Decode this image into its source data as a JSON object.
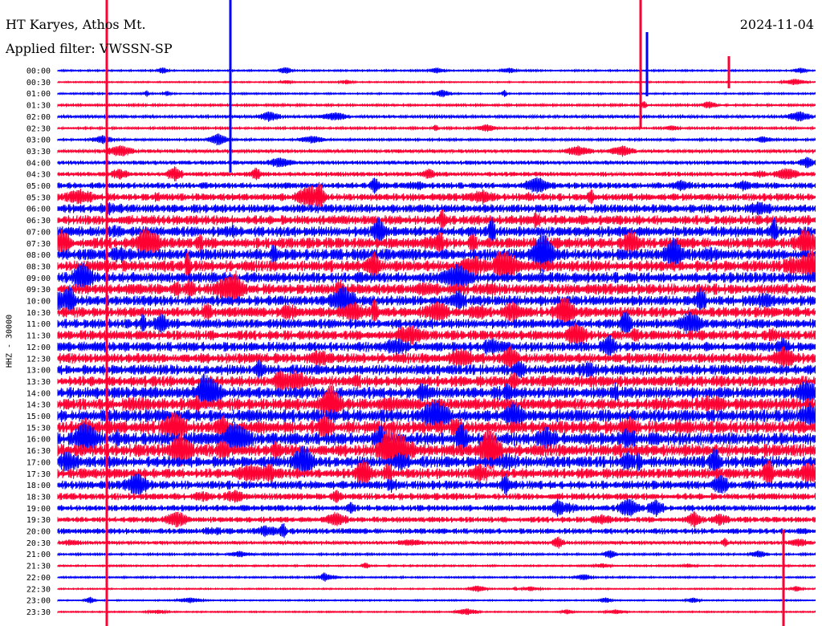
{
  "header": {
    "station": "HT Karyes, Athos Mt.",
    "filter": "Applied filter: VWSSN-SP",
    "date": "2024-11-04"
  },
  "chart_data": {
    "type": "line",
    "title": "HT Karyes, Athos Mt.",
    "subtitle": "Applied filter: VWSSN-SP",
    "date": "2024-11-04",
    "ylabel": "HHZ - 30000",
    "trace_colors": [
      "#0000ff",
      "#ff0033"
    ],
    "row_labels": [
      "00:00",
      "00:30",
      "01:00",
      "01:30",
      "02:00",
      "02:30",
      "03:00",
      "03:30",
      "04:00",
      "04:30",
      "05:00",
      "05:30",
      "06:00",
      "06:30",
      "07:00",
      "07:30",
      "08:00",
      "08:30",
      "09:00",
      "09:30",
      "10:00",
      "10:30",
      "11:00",
      "11:30",
      "12:00",
      "12:30",
      "13:00",
      "13:30",
      "14:00",
      "14:30",
      "15:00",
      "15:30",
      "16:00",
      "16:30",
      "17:00",
      "17:30",
      "18:00",
      "18:30",
      "19:00",
      "19:30",
      "20:00",
      "20:30",
      "21:00",
      "21:30",
      "22:00",
      "22:30",
      "23:00",
      "23:30"
    ],
    "row_amplitude": [
      0.15,
      0.12,
      0.15,
      0.2,
      0.25,
      0.2,
      0.2,
      0.3,
      0.35,
      0.4,
      0.55,
      0.65,
      0.75,
      0.85,
      0.9,
      0.95,
      1.0,
      1.0,
      0.95,
      0.95,
      0.9,
      0.9,
      0.85,
      0.85,
      0.85,
      0.9,
      0.9,
      0.95,
      1.0,
      1.05,
      1.1,
      1.1,
      1.1,
      1.1,
      1.0,
      0.9,
      0.75,
      0.6,
      0.55,
      0.5,
      0.5,
      0.3,
      0.18,
      0.15,
      0.15,
      0.12,
      0.12,
      0.12
    ]
  }
}
